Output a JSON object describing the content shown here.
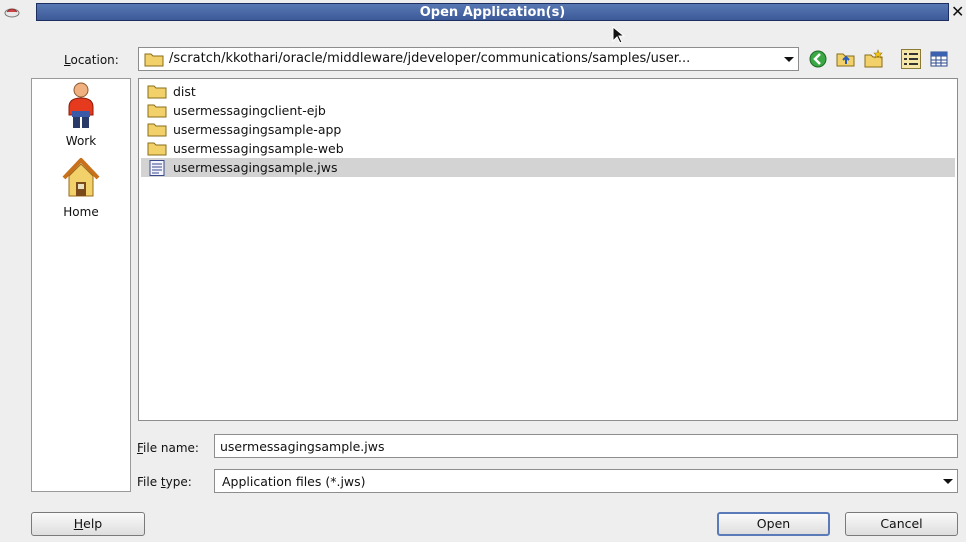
{
  "window": {
    "title": "Open Application(s)",
    "close_glyph": "✕",
    "app_icon": "duke-app-icon"
  },
  "location": {
    "label_mnemonic": "L",
    "label_rest": "ocation:",
    "path": "/scratch/kkothari/oracle/middleware/jdeveloper/communications/samples/user...",
    "toolbar": [
      "back-icon",
      "up-folder-icon",
      "new-folder-icon",
      "list-view-icon",
      "details-view-icon"
    ]
  },
  "places": [
    {
      "label": "Work",
      "icon": "work-user-icon"
    },
    {
      "label": "Home",
      "icon": "home-icon"
    }
  ],
  "files": [
    {
      "name": "dist",
      "type": "folder",
      "selected": false
    },
    {
      "name": "usermessagingclient-ejb",
      "type": "folder",
      "selected": false
    },
    {
      "name": "usermessagingsample-app",
      "type": "folder",
      "selected": false
    },
    {
      "name": "usermessagingsample-web",
      "type": "folder",
      "selected": false
    },
    {
      "name": "usermessagingsample.jws",
      "type": "file",
      "selected": true
    }
  ],
  "file_name": {
    "label_mnemonic": "F",
    "label_rest": "ile name:",
    "value": "usermessagingsample.jws"
  },
  "file_type": {
    "label_pre": "File ",
    "label_mnemonic": "t",
    "label_rest": "ype:",
    "value": "Application files (*.jws)"
  },
  "buttons": {
    "help_mnemonic": "H",
    "help_rest": "elp",
    "open": "Open",
    "cancel": "Cancel"
  },
  "colors": {
    "title_bar": "#4a6aa8",
    "selection": "#d3d3d3",
    "folder": "#f2d16b",
    "default_button_border": "#5a7bb8"
  }
}
